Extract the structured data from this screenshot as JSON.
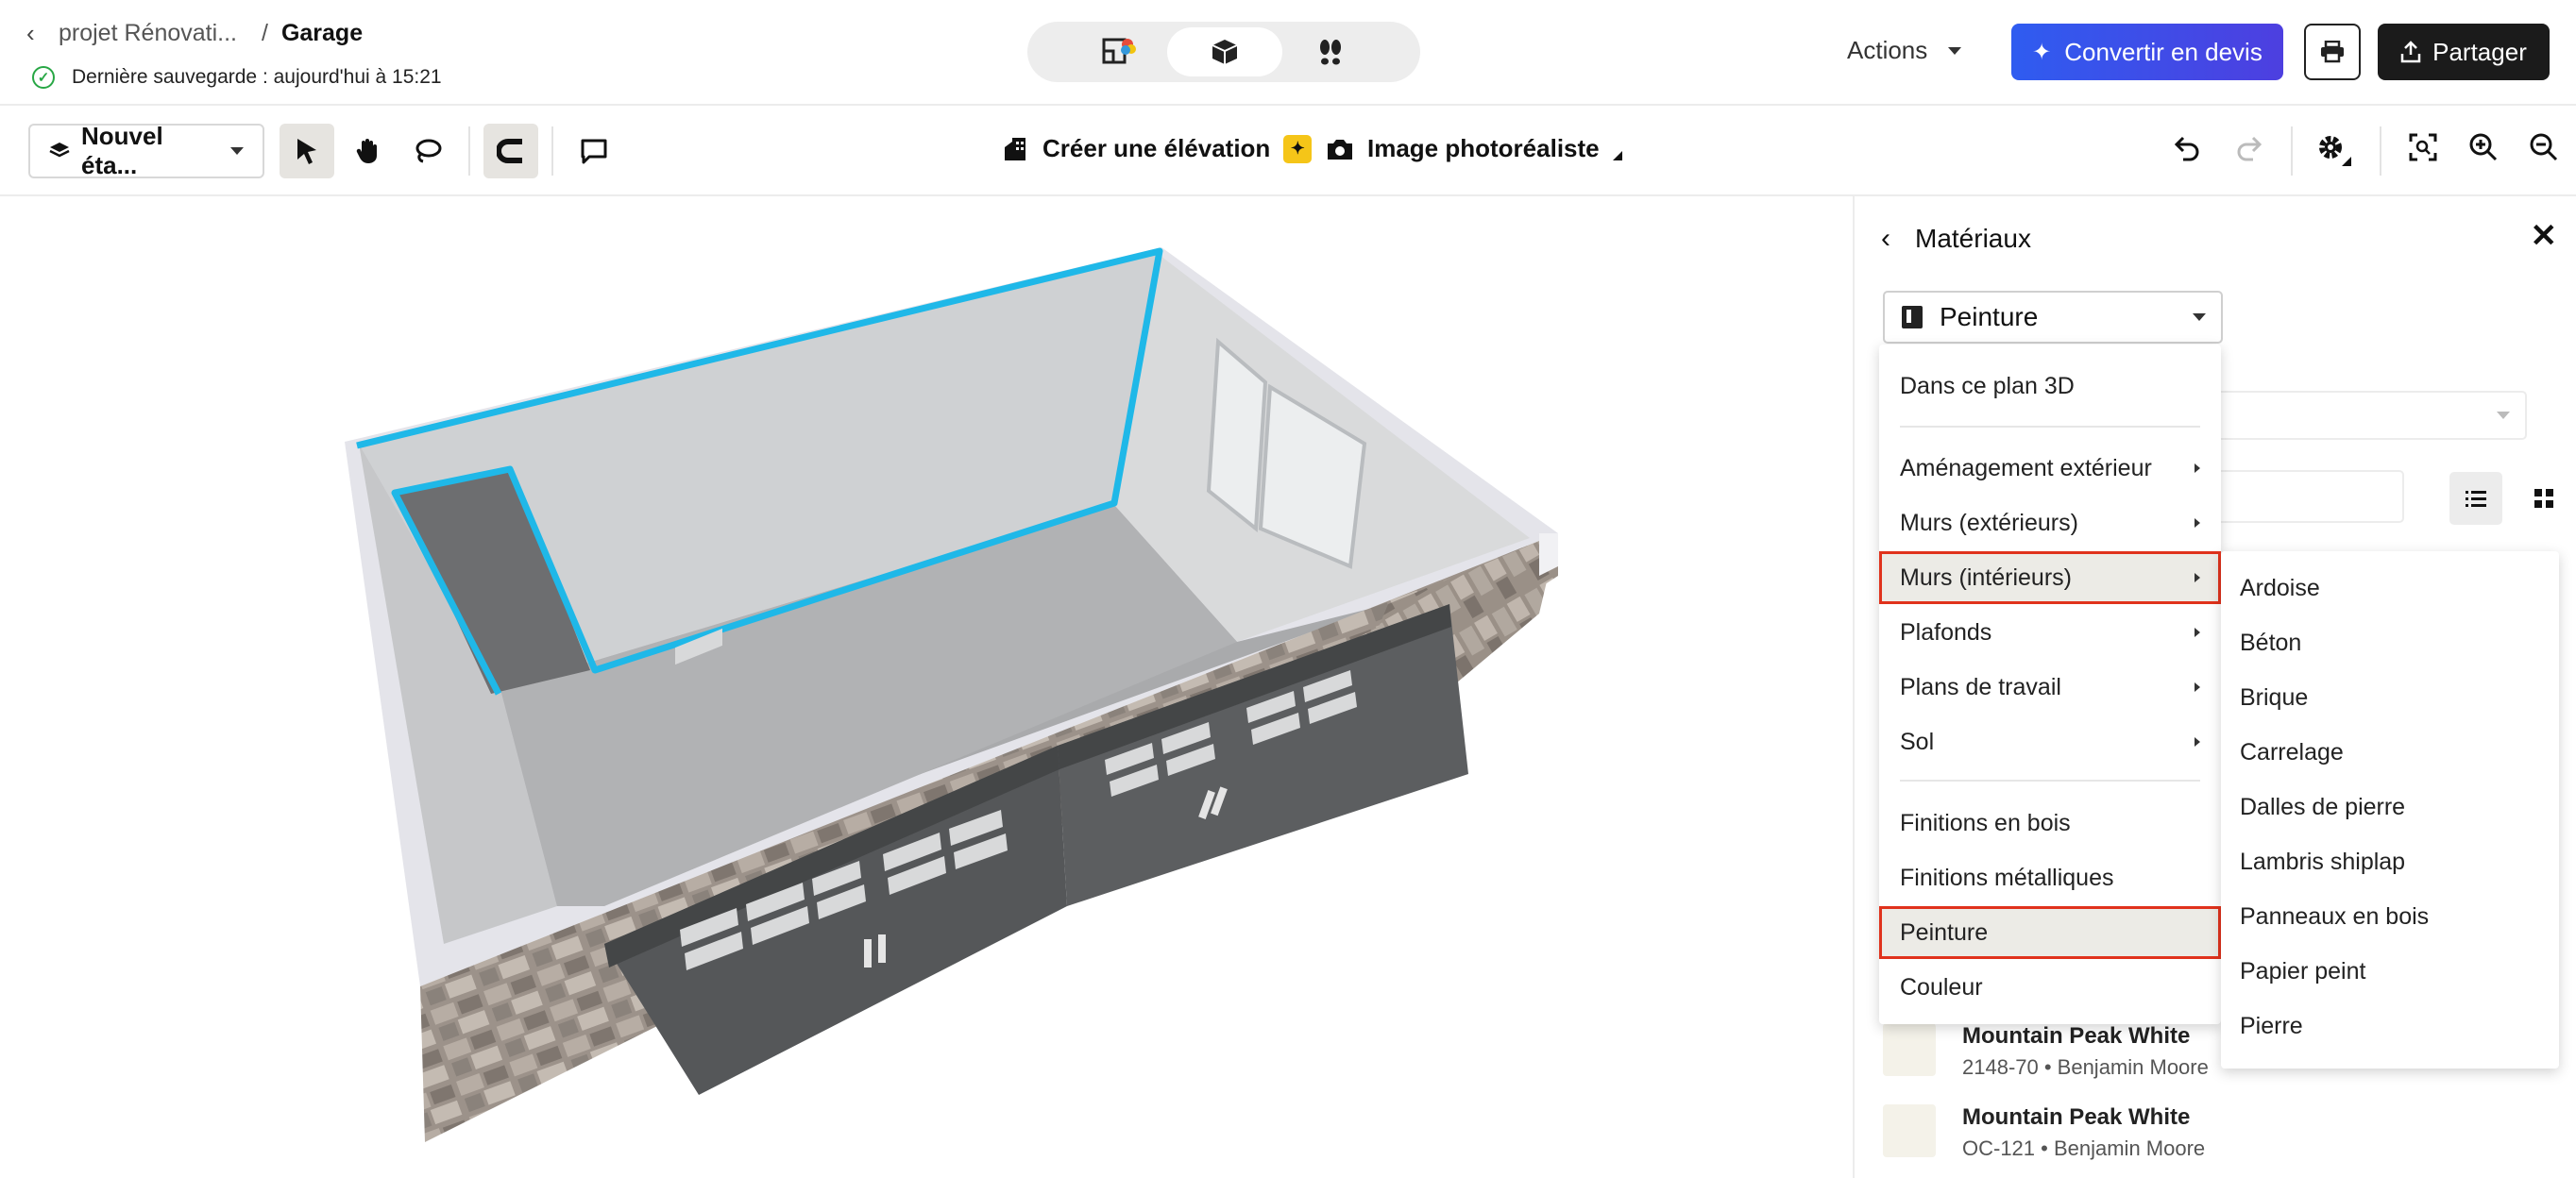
{
  "header": {
    "project": "projet Rénovati...",
    "separator": "/",
    "current": "Garage",
    "save_status": "Dernière sauvegarde : aujourd'hui à 15:21",
    "actions_label": "Actions",
    "convert_label": "Convertir en devis",
    "share_label": "Partager"
  },
  "toolbar": {
    "level_label": "Nouvel éta...",
    "elevation_label": "Créer une élévation",
    "photo_label": "Image photoréaliste"
  },
  "panel": {
    "title": "Matériaux",
    "category": "Peinture",
    "swatches": [
      {
        "name": "Mountain Peak White",
        "sub": "2148-70 • Benjamin Moore"
      },
      {
        "name": "Mountain Peak White",
        "sub": "OC-121 • Benjamin Moore"
      }
    ]
  },
  "menu": {
    "items": [
      {
        "label": "Dans ce plan 3D"
      },
      {
        "label": "Aménagement extérieur"
      },
      {
        "label": "Murs (extérieurs)"
      },
      {
        "label": "Murs (intérieurs)"
      },
      {
        "label": "Plafonds"
      },
      {
        "label": "Plans de travail"
      },
      {
        "label": "Sol"
      },
      {
        "label": "Finitions en bois"
      },
      {
        "label": "Finitions métalliques"
      },
      {
        "label": "Peinture"
      },
      {
        "label": "Couleur"
      }
    ]
  },
  "submenu": {
    "items": [
      {
        "label": "Ardoise"
      },
      {
        "label": "Béton"
      },
      {
        "label": "Brique"
      },
      {
        "label": "Carrelage"
      },
      {
        "label": "Dalles de pierre"
      },
      {
        "label": "Lambris shiplap"
      },
      {
        "label": "Panneaux en bois"
      },
      {
        "label": "Papier peint"
      },
      {
        "label": "Pierre"
      }
    ]
  },
  "colors": {
    "accent": "#2f5cf0",
    "highlight_border": "#e0321c",
    "selection_outline": "#1fb8e8",
    "success": "#28a745"
  }
}
